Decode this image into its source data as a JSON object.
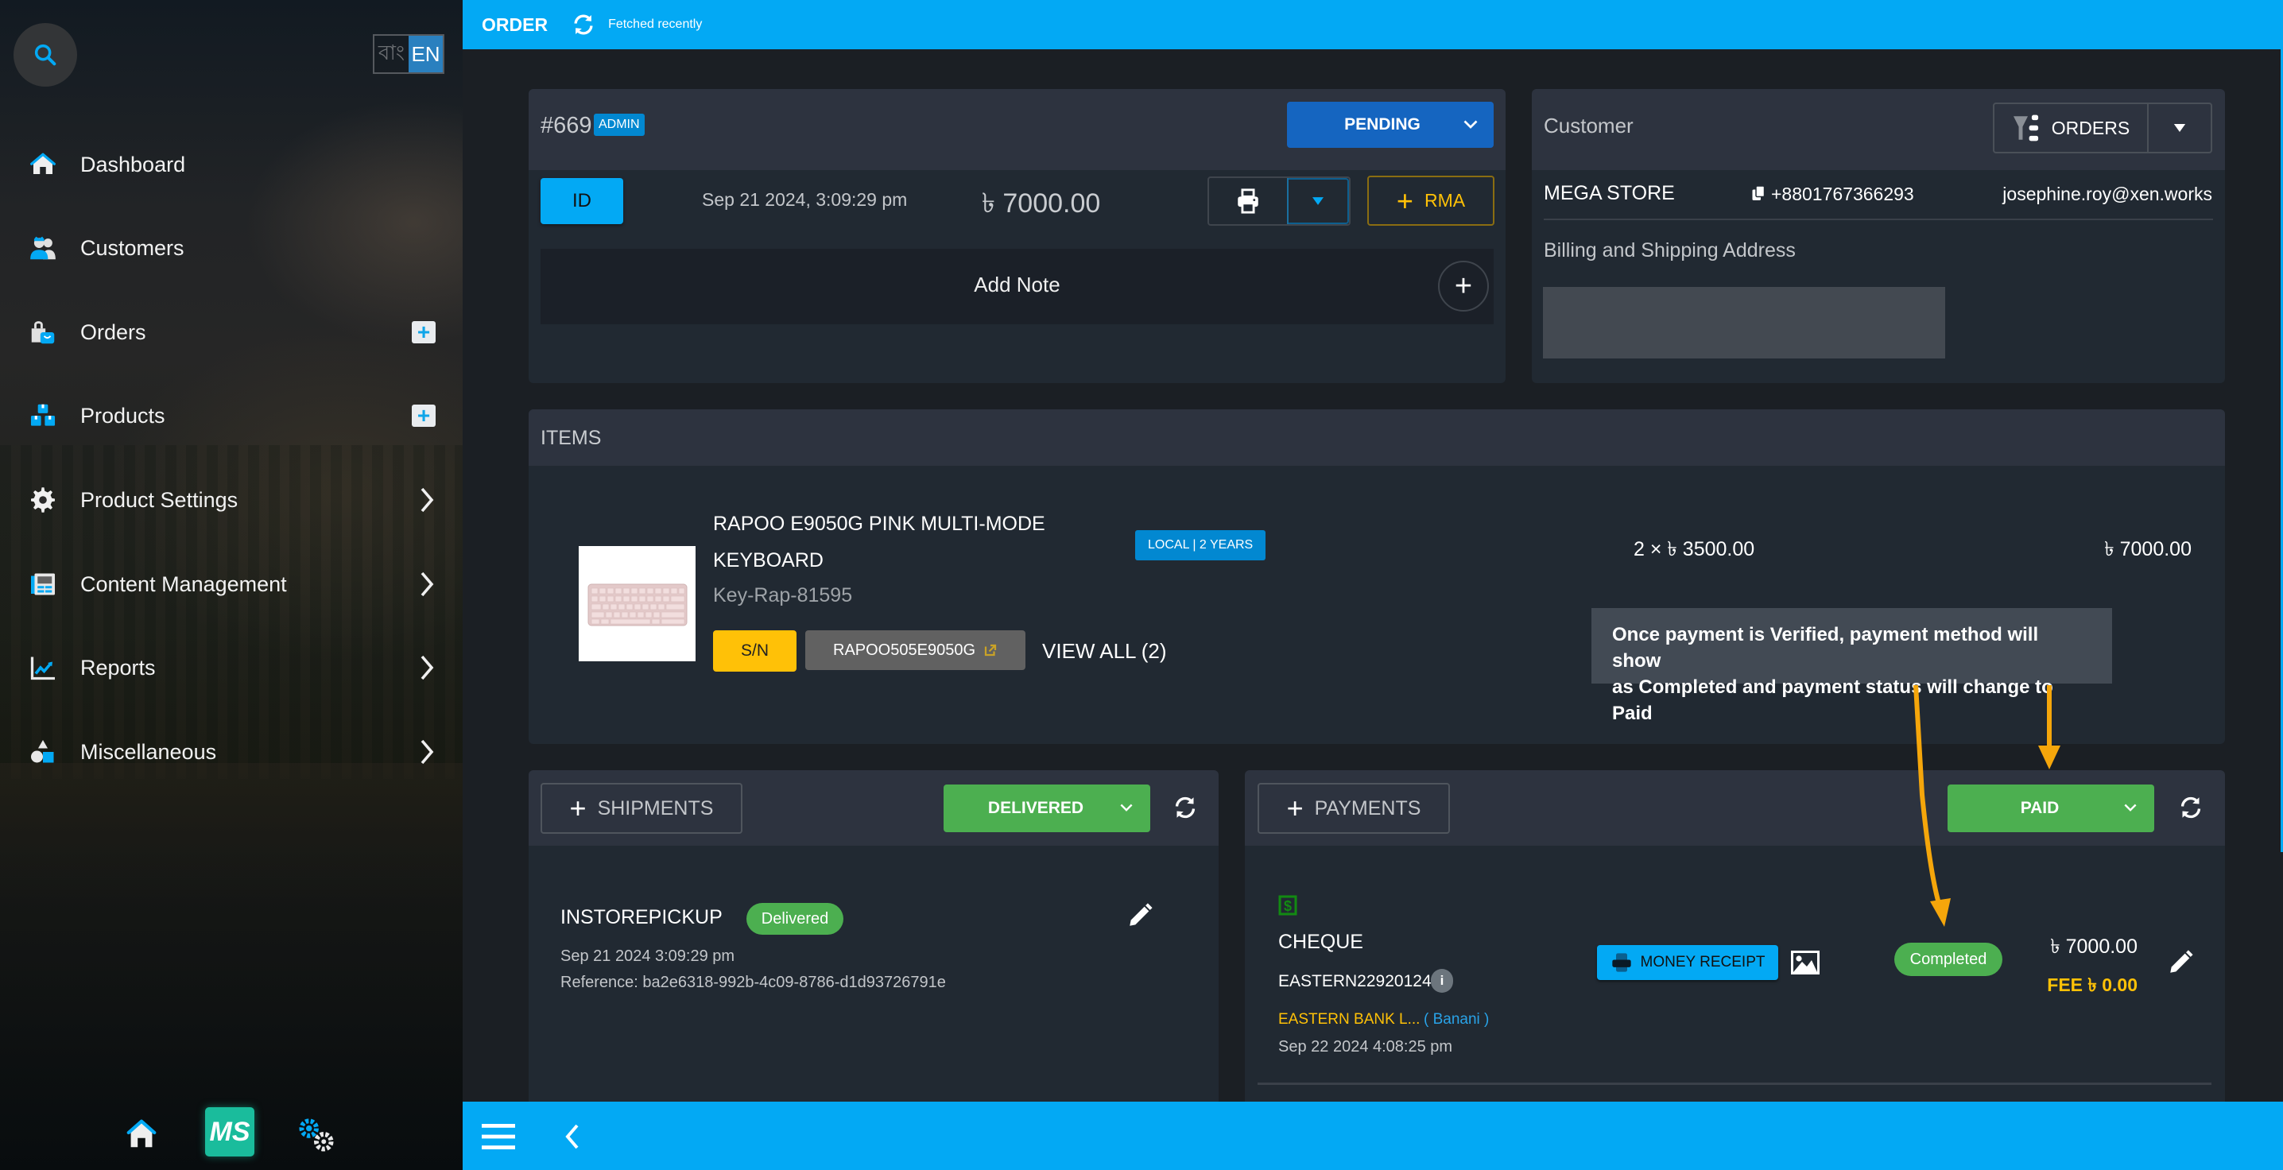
{
  "sidebar": {
    "search_icon": "search-icon",
    "lang": {
      "bn": "বাং",
      "en": "EN",
      "active": "EN"
    },
    "items": [
      {
        "label": "Dashboard",
        "icon": "home-icon",
        "action": "none"
      },
      {
        "label": "Customers",
        "icon": "customers-icon",
        "action": "none"
      },
      {
        "label": "Orders",
        "icon": "orders-bag-icon",
        "action": "add"
      },
      {
        "label": "Products",
        "icon": "products-boxes-icon",
        "action": "add"
      },
      {
        "label": "Product Settings",
        "icon": "gear-icon",
        "action": "expand"
      },
      {
        "label": "Content Management",
        "icon": "content-icon",
        "action": "expand"
      },
      {
        "label": "Reports",
        "icon": "chart-icon",
        "action": "expand"
      },
      {
        "label": "Miscellaneous",
        "icon": "shapes-icon",
        "action": "expand"
      }
    ],
    "bottom": {
      "logo_text": "MS"
    }
  },
  "topbar": {
    "title": "ORDER",
    "status": "Fetched recently"
  },
  "order": {
    "number": "#669",
    "badge": "ADMIN",
    "status": "PENDING",
    "id_button": "ID",
    "date": "Sep 21 2024, 3:09:29 pm",
    "total": "৳ 7000.00",
    "rma_label": "RMA",
    "add_note": "Add Note"
  },
  "customer": {
    "title": "Customer",
    "orders_button": "ORDERS",
    "name": "MEGA STORE",
    "phone": "+8801767366293",
    "email": "josephine.roy@xen.works",
    "address_title": "Billing and Shipping Address"
  },
  "items": {
    "title": "ITEMS",
    "list": [
      {
        "name_line1": "RAPOO E9050G PINK MULTI-MODE",
        "name_line2": "KEYBOARD",
        "sku": "Key-Rap-81595",
        "warranty": "LOCAL | 2 YEARS",
        "sn_label": "S/N",
        "serial": "RAPOO505E9050G",
        "view_all": "VIEW ALL (2)",
        "qty_price": "2 × ৳ 3500.00",
        "line_total": "৳ 7000.00"
      }
    ]
  },
  "annotation": {
    "text_line1": "Once payment is Verified, payment method will show",
    "text_line2": "as Completed and payment status will change to Paid",
    "arrow_color": "#f5a60b"
  },
  "shipments": {
    "add_label": "SHIPMENTS",
    "status": "DELIVERED",
    "entries": [
      {
        "method": "INSTOREPICKUP",
        "badge": "Delivered",
        "date": "Sep 21 2024 3:09:29 pm",
        "reference": "Reference: ba2e6318-992b-4c09-8786-d1d93726791e"
      }
    ]
  },
  "payments": {
    "add_label": "PAYMENTS",
    "status": "PAID",
    "entries": [
      {
        "method": "CHEQUE",
        "cheque_no": "EASTERN22920124",
        "bank": "EASTERN BANK L...",
        "branch": "( Banani )",
        "date": "Sep 22 2024 4:08:25 pm",
        "receipt_label": "MONEY RECEIPT",
        "badge": "Completed",
        "amount": "৳ 7000.00",
        "fee": "FEE ৳ 0.00"
      }
    ]
  },
  "colors": {
    "primary": "#03a9f4",
    "pending": "#1565c0",
    "success": "#4caf50",
    "warning": "#ffc107",
    "accent_orange": "#f5a60b"
  }
}
